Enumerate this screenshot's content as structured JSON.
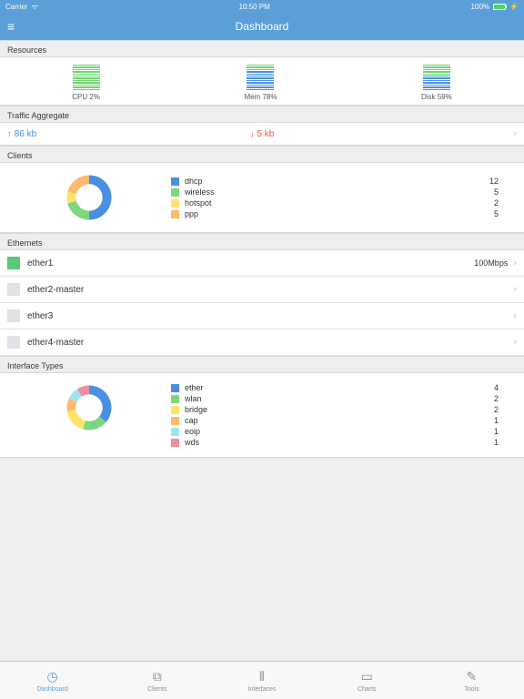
{
  "status_bar": {
    "carrier": "Carrier",
    "time": "10:50 PM",
    "battery": "100%"
  },
  "nav": {
    "title": "Dashboard"
  },
  "sections": {
    "resources": {
      "header": "Resources",
      "items": [
        {
          "label": "CPU 2%",
          "pct": 2,
          "color": "#6fd36f"
        },
        {
          "label": "Mem 78%",
          "pct": 78,
          "color": "#4a90e2"
        },
        {
          "label": "Disk 59%",
          "pct": 59,
          "color": "#4a90e2"
        }
      ]
    },
    "traffic": {
      "header": "Traffic Aggregate",
      "up": "↑ 86 kb",
      "down": "↓ 5 kb"
    },
    "clients": {
      "header": "Clients",
      "items": [
        {
          "label": "dhcp",
          "value": 12,
          "color": "#4a90e2"
        },
        {
          "label": "wireless",
          "value": 5,
          "color": "#7ed67e"
        },
        {
          "label": "hotspot",
          "value": 2,
          "color": "#ffe36b"
        },
        {
          "label": "ppp",
          "value": 5,
          "color": "#ffb96b"
        }
      ]
    },
    "ethernets": {
      "header": "Ethernets",
      "items": [
        {
          "label": "ether1",
          "speed": "100Mbps",
          "color": "#5bc978"
        },
        {
          "label": "ether2-master",
          "speed": "",
          "color": "#dfe2e6"
        },
        {
          "label": "ether3",
          "speed": "",
          "color": "#dfe2e6"
        },
        {
          "label": "ether4-master",
          "speed": "",
          "color": "#dfe2e6"
        }
      ]
    },
    "iftypes": {
      "header": "Interface Types",
      "items": [
        {
          "label": "ether",
          "value": 4,
          "color": "#4a90e2"
        },
        {
          "label": "wlan",
          "value": 2,
          "color": "#7ed67e"
        },
        {
          "label": "bridge",
          "value": 2,
          "color": "#ffe36b"
        },
        {
          "label": "cap",
          "value": 1,
          "color": "#ffb96b"
        },
        {
          "label": "eoip",
          "value": 1,
          "color": "#a0e6f0"
        },
        {
          "label": "wds",
          "value": 1,
          "color": "#f08ba0"
        }
      ]
    }
  },
  "tabs": [
    {
      "label": "Dashboard",
      "icon": "◷",
      "active": true
    },
    {
      "label": "Clients",
      "icon": "⧉",
      "active": false
    },
    {
      "label": "Interfaces",
      "icon": "⦀",
      "active": false
    },
    {
      "label": "Charts",
      "icon": "▭",
      "active": false
    },
    {
      "label": "Tools",
      "icon": "✎",
      "active": false
    }
  ],
  "chart_data": [
    {
      "type": "bar",
      "title": "Resources",
      "categories": [
        "CPU",
        "Mem",
        "Disk"
      ],
      "values": [
        2,
        78,
        59
      ],
      "ylim": [
        0,
        100
      ],
      "ylabel": "percent"
    },
    {
      "type": "pie",
      "title": "Clients",
      "categories": [
        "dhcp",
        "wireless",
        "hotspot",
        "ppp"
      ],
      "values": [
        12,
        5,
        2,
        5
      ]
    },
    {
      "type": "pie",
      "title": "Interface Types",
      "categories": [
        "ether",
        "wlan",
        "bridge",
        "cap",
        "eoip",
        "wds"
      ],
      "values": [
        4,
        2,
        2,
        1,
        1,
        1
      ]
    }
  ]
}
